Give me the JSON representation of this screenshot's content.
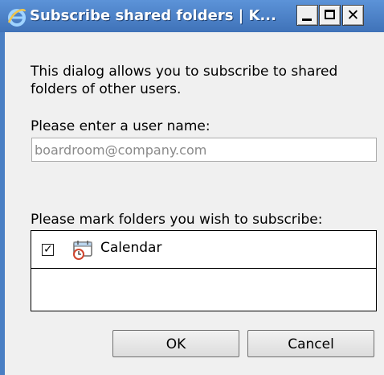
{
  "window": {
    "title": "Subscribe shared folders | K...",
    "icon": "browser-e-icon",
    "colors": {
      "titlebar": "#4a7fc4",
      "client": "#f0f0f0"
    }
  },
  "dialog": {
    "description": "This dialog allows you to subscribe to shared folders of other users.",
    "user_label": "Please enter a user name:",
    "user_placeholder": "boardroom@company.com",
    "folders_label": "Please mark folders you wish to subscribe:",
    "folders": [
      {
        "label": "Calendar",
        "checked": true,
        "icon": "calendar-icon"
      }
    ],
    "ok_label": "OK",
    "cancel_label": "Cancel"
  }
}
